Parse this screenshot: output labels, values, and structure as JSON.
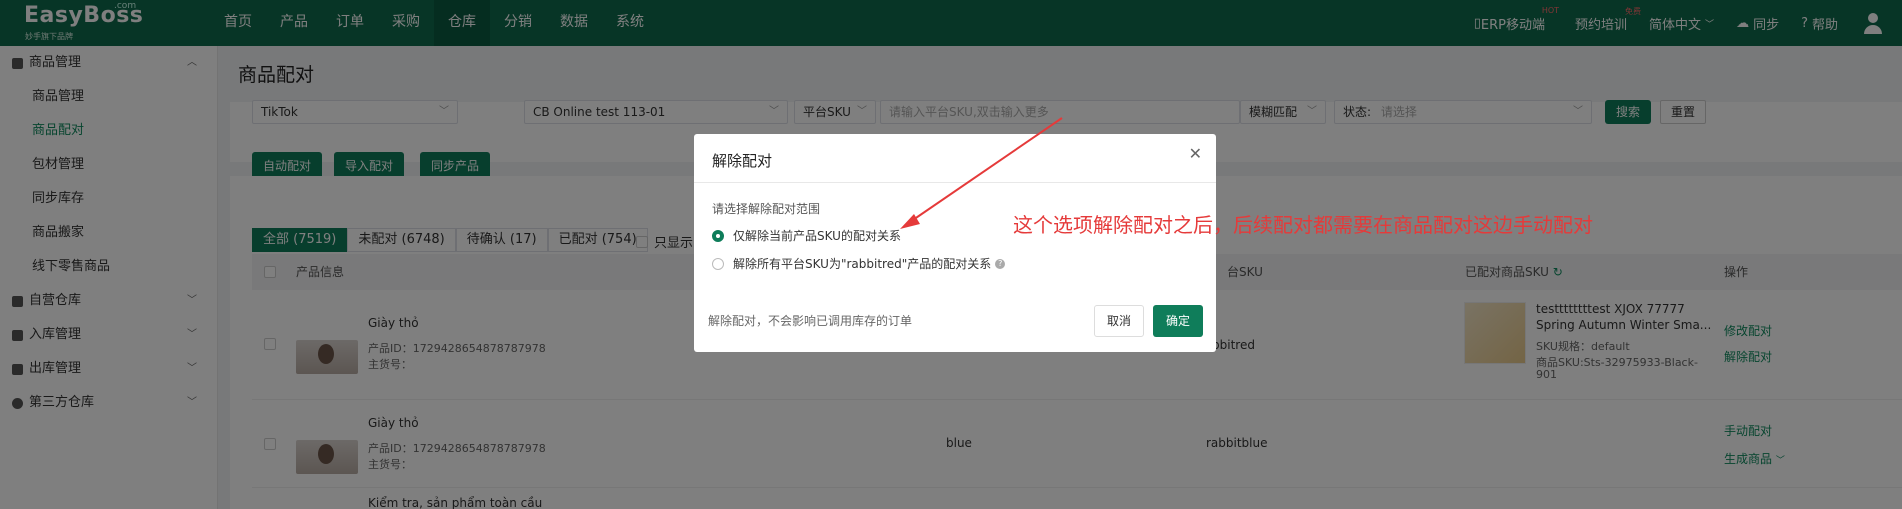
{
  "app": {
    "logo": "EasyBoss",
    "logo_com": ".com",
    "logo_sub": "妙手旗下品牌"
  },
  "nav": [
    "首页",
    "产品",
    "订单",
    "采购",
    "仓库",
    "分销",
    "数据",
    "系统"
  ],
  "top_right": {
    "erp": "ERP移动端",
    "erp_badge": "HOT",
    "training": "预约培训",
    "training_badge": "免费",
    "language": "简体中文",
    "sync": "同步",
    "help": "帮助"
  },
  "sidebar": {
    "group_goods": "商品管理",
    "items": [
      "商品管理",
      "商品配对",
      "包材管理",
      "同步库存",
      "商品搬家",
      "线下零售商品"
    ],
    "groups": [
      "自营仓库",
      "入库管理",
      "出库管理",
      "第三方仓库"
    ]
  },
  "page": {
    "title": "商品配对",
    "filters": {
      "platform": "TikTok",
      "shop": "CB Online test 113-01",
      "sku_type": "平台SKU",
      "sku_placeholder": "请输入平台SKU,双击输入更多",
      "match_mode": "模糊匹配",
      "status_label": "状态:",
      "status_placeholder": "请选择",
      "search": "搜索",
      "reset": "重置"
    },
    "actions": {
      "auto_pair": "自动配对",
      "import_pair": "导入配对",
      "sync_products": "同步产品"
    },
    "tabs": [
      "全部 (7519)",
      "未配对 (6748)",
      "待确认 (17)",
      "已配对 (754)"
    ],
    "only_show": "只显示",
    "table_headers": {
      "product_info": "产品信息",
      "platform_sku_partial": "台SKU",
      "paired_sku": "已配对商品SKU",
      "ops": "操作"
    },
    "rows": [
      {
        "name": "Giày thỏ",
        "product_id": "产品ID：1729428654878787978",
        "goods_no": "主货号：",
        "platform_sku": "bbitred",
        "paired_title": "testtttttttest XJOX 77777",
        "paired_title2": "Spring Autumn Winter Sma...",
        "paired_spec": "SKU规格：default",
        "paired_sku": "商品SKU:Sts-32975933-Black-",
        "paired_sku2": "901",
        "op1": "修改配对",
        "op2": "解除配对"
      },
      {
        "name": "Giày thỏ",
        "product_id": "产品ID：1729428654878787978",
        "goods_no": "主货号：",
        "variation": "blue",
        "platform_sku": "rabbitblue",
        "op1": "手动配对",
        "op2": "生成商品"
      },
      {
        "name": "Kiểm tra, sản phẩm toàn cầu"
      }
    ]
  },
  "modal": {
    "title": "解除配对",
    "scope_label": "请选择解除配对范围",
    "option1": "仅解除当前产品SKU的配对关系",
    "option2": "解除所有平台SKU为\"rabbitred\"产品的配对关系",
    "note": "解除配对，不会影响已调用库存的订单",
    "cancel": "取消",
    "ok": "确定"
  },
  "annotation": "这个选项解除配对之后，后续配对都需要在商品配对这边手动配对"
}
